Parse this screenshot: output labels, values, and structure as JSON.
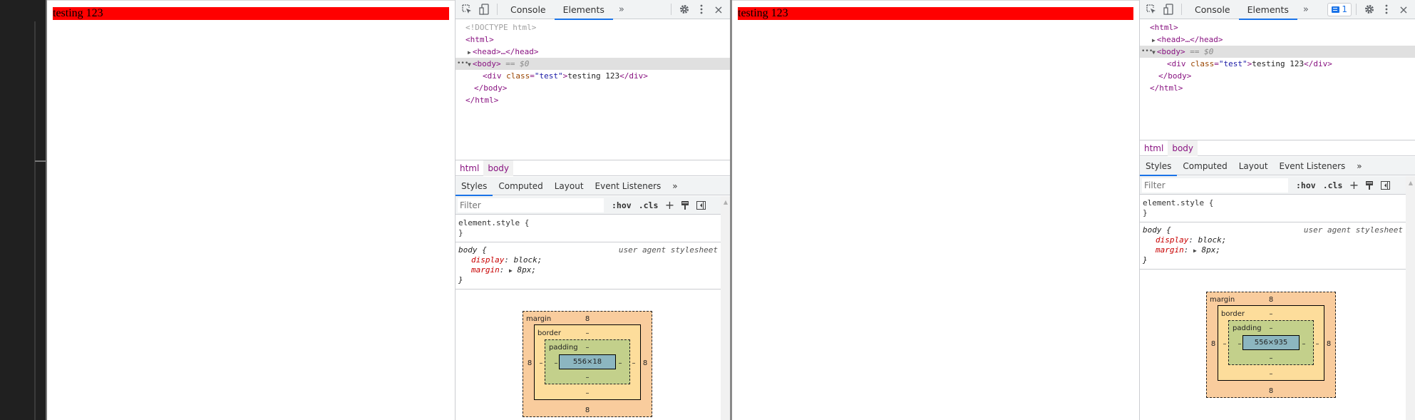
{
  "left_pane": {
    "page": {
      "div_text": "testing 123",
      "highlight_color": "#ff0000"
    },
    "devtools": {
      "toolbar": {
        "inspect_icon": "inspect-element-icon",
        "device_icon": "device-toolbar-icon",
        "tabs": [
          {
            "label": "Console"
          },
          {
            "label": "Elements",
            "active": true
          }
        ],
        "more_tabs": "»",
        "settings_icon": "gear-icon",
        "menu_icon": "vertical-dots-icon",
        "close_icon": "×"
      },
      "dom": {
        "doctype": "<!DOCTYPE html>",
        "html_open": "<html>",
        "head": "<head>…</head>",
        "body_open": "<body>",
        "body_marker": "== $0",
        "div_open_tag": "<div",
        "div_attr_name": "class",
        "div_attr_value": "\"test\"",
        "div_text": "testing 123",
        "div_close": "</div>",
        "body_close": "</body>",
        "html_close": "</html>"
      },
      "breadcrumbs": [
        {
          "label": "html"
        },
        {
          "label": "body",
          "selected": true
        }
      ],
      "panel_tabs": [
        {
          "label": "Styles",
          "active": true
        },
        {
          "label": "Computed"
        },
        {
          "label": "Layout"
        },
        {
          "label": "Event Listeners"
        }
      ],
      "panel_more": "»",
      "filter": {
        "placeholder": "Filter",
        "hov": ":hov",
        "cls": ".cls",
        "add": "+"
      },
      "styles": {
        "element_style_selector": "element.style {",
        "close_brace": "}",
        "body_selector": "body {",
        "source": "user agent stylesheet",
        "props": [
          {
            "name": "display",
            "value": "block;"
          },
          {
            "name": "margin",
            "value": "8px;"
          }
        ]
      },
      "box_model": {
        "margin_label": "margin",
        "border_label": "border",
        "padding_label": "padding",
        "margin": {
          "top": "8",
          "right": "8",
          "bottom": "8",
          "left": "8"
        },
        "border": {
          "top": "–",
          "right": "–",
          "bottom": "–",
          "left": "–"
        },
        "padding": {
          "top": "–",
          "right": "–",
          "bottom": "–",
          "left": "–"
        },
        "content": "556×18"
      }
    }
  },
  "right_pane": {
    "page": {
      "div_text": "testing 123",
      "highlight_color": "#ff0000"
    },
    "devtools": {
      "toolbar": {
        "tabs": [
          {
            "label": "Console"
          },
          {
            "label": "Elements",
            "active": true
          }
        ],
        "more_tabs": "»",
        "issues_badge": {
          "icon": "message-icon",
          "count": "1"
        },
        "close_icon": "×"
      },
      "dom": {
        "html_open": "<html>",
        "head": "<head>…</head>",
        "body_open": "<body>",
        "body_marker": "== $0",
        "div_open_tag": "<div",
        "div_attr_name": "class",
        "div_attr_value": "\"test\"",
        "div_text": "testing 123",
        "div_close": "</div>",
        "body_close": "</body>",
        "html_close": "</html>"
      },
      "breadcrumbs": [
        {
          "label": "html"
        },
        {
          "label": "body",
          "selected": true
        }
      ],
      "panel_tabs": [
        {
          "label": "Styles",
          "active": true
        },
        {
          "label": "Computed"
        },
        {
          "label": "Layout"
        },
        {
          "label": "Event Listeners"
        }
      ],
      "panel_more": "»",
      "filter": {
        "placeholder": "Filter",
        "hov": ":hov",
        "cls": ".cls",
        "add": "+"
      },
      "styles": {
        "element_style_selector": "element.style {",
        "close_brace": "}",
        "body_selector": "body {",
        "source": "user agent stylesheet",
        "props": [
          {
            "name": "display",
            "value": "block;"
          },
          {
            "name": "margin",
            "value": "8px;"
          }
        ]
      },
      "box_model": {
        "margin_label": "margin",
        "border_label": "border",
        "padding_label": "padding",
        "margin": {
          "top": "8",
          "right": "8",
          "bottom": "8",
          "left": "8"
        },
        "border": {
          "top": "–",
          "right": "–",
          "bottom": "–",
          "left": "–"
        },
        "padding": {
          "top": "–",
          "right": "–",
          "bottom": "–",
          "left": "–"
        },
        "content": "556×935"
      }
    }
  }
}
